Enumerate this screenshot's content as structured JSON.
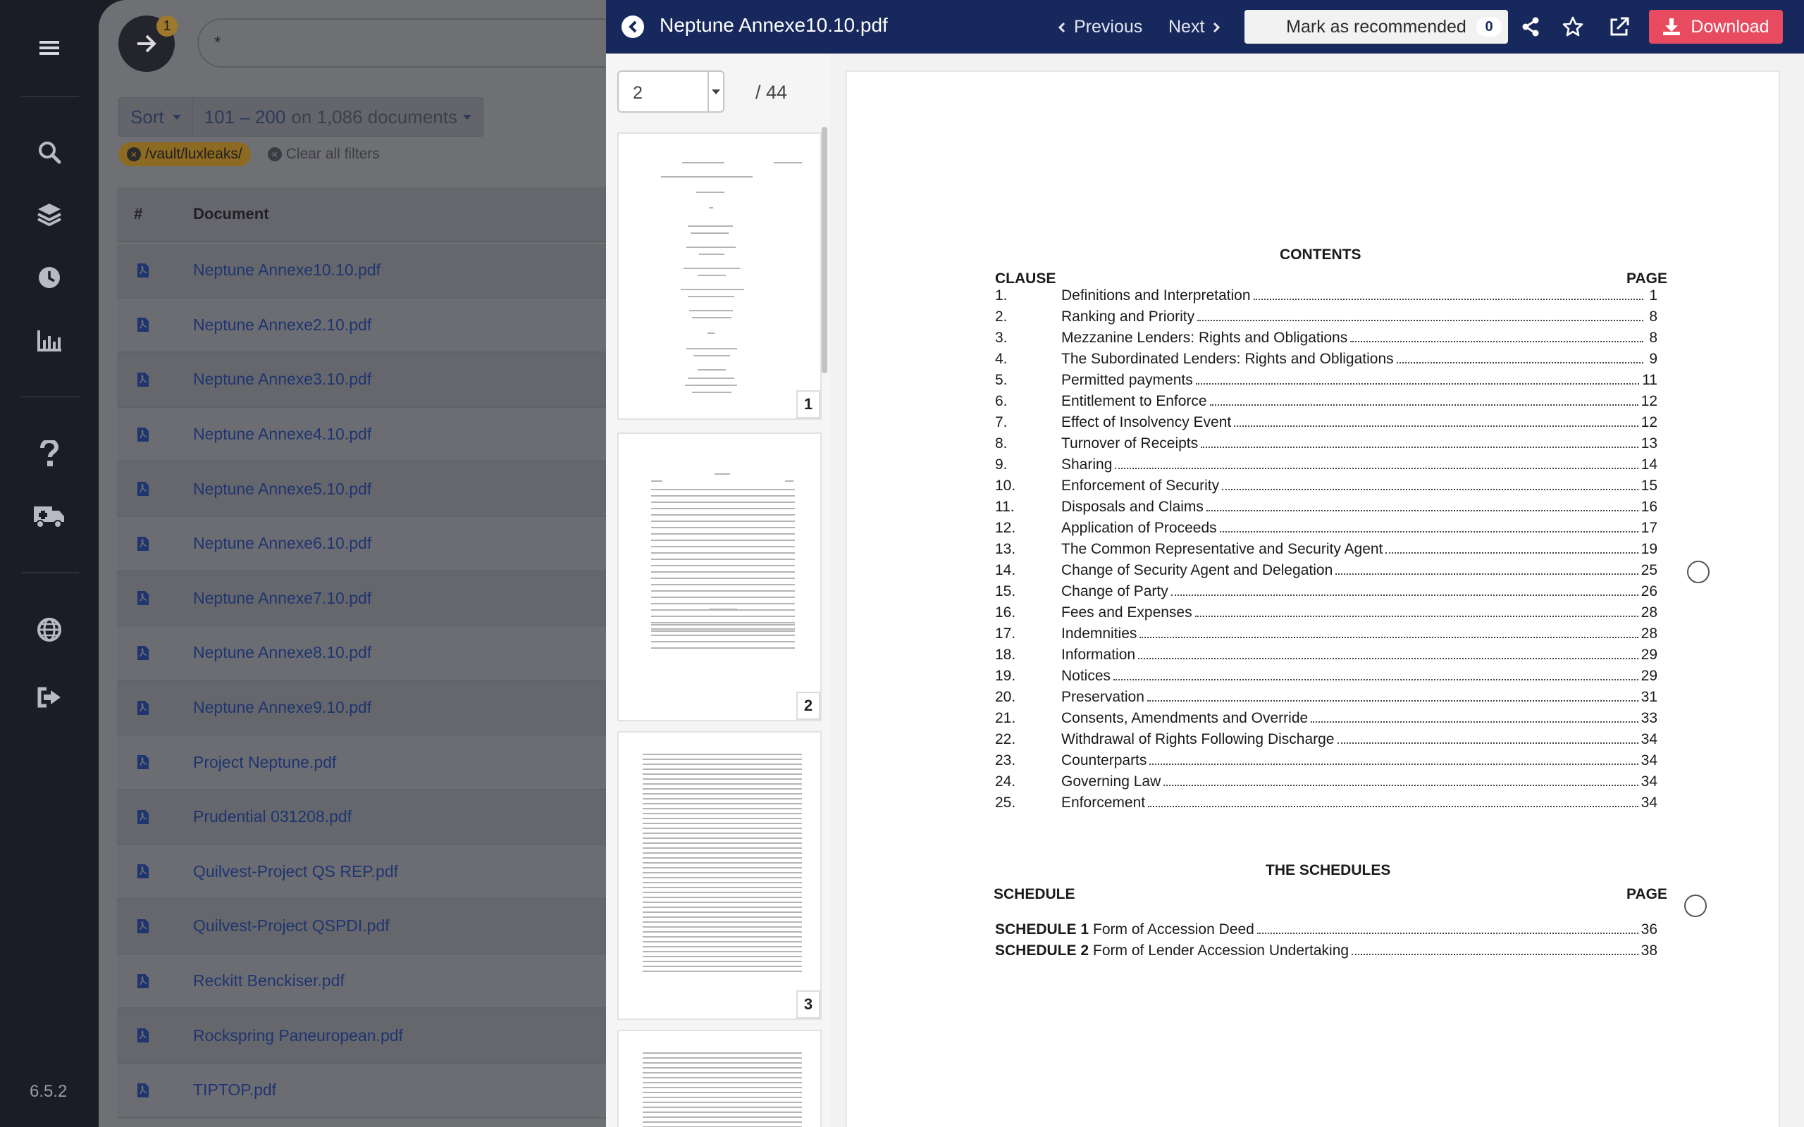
{
  "app": {
    "version": "6.5.2",
    "sidebar_icons": [
      "menu-icon",
      "search-icon",
      "layers-icon",
      "history-icon",
      "chart-icon",
      "help-icon",
      "truck-icon",
      "globe-icon",
      "logout-icon"
    ]
  },
  "search": {
    "go_badge": "1",
    "query": "*",
    "sort_label": "Sort",
    "range": "101 – 200",
    "range_suffix": "on 1,086 documents",
    "path_filter": "/vault/luxleaks/",
    "clear_filters": "Clear all filters",
    "col_num": "#",
    "col_document": "Document",
    "documents": [
      "Neptune Annexe10.10.pdf",
      "Neptune Annexe2.10.pdf",
      "Neptune Annexe3.10.pdf",
      "Neptune Annexe4.10.pdf",
      "Neptune Annexe5.10.pdf",
      "Neptune Annexe6.10.pdf",
      "Neptune Annexe7.10.pdf",
      "Neptune Annexe8.10.pdf",
      "Neptune Annexe9.10.pdf",
      "Project Neptune.pdf",
      "Prudential 031208.pdf",
      "Quilvest-Project QS REP.pdf",
      "Quilvest-Project QSPDI.pdf",
      "Reckitt Benckiser.pdf",
      "Rockspring Paneuropean.pdf",
      "TIPTOP.pdf"
    ]
  },
  "viewer": {
    "title": "Neptune Annexe10.10.pdf",
    "previous": "Previous",
    "next": "Next",
    "recommend": "Mark as recommended",
    "recommend_count": "0",
    "download": "Download",
    "accent": "#e84a5f",
    "header_bg": "#17295c",
    "current_page": "2",
    "total_pages": "/ 44",
    "thumb_pages": [
      "1",
      "2",
      "3"
    ]
  },
  "document": {
    "contents_title": "CONTENTS",
    "clause_label": "CLAUSE",
    "page_label": "PAGE",
    "toc": [
      {
        "num": "1.",
        "title": "Definitions and Interpretation",
        "page": "1"
      },
      {
        "num": "2.",
        "title": "Ranking and Priority",
        "page": "8"
      },
      {
        "num": "3.",
        "title": "Mezzanine Lenders: Rights and Obligations",
        "page": "8"
      },
      {
        "num": "4.",
        "title": "The Subordinated Lenders: Rights and Obligations",
        "page": "9"
      },
      {
        "num": "5.",
        "title": "Permitted payments",
        "page": "11"
      },
      {
        "num": "6.",
        "title": "Entitlement to Enforce",
        "page": "12"
      },
      {
        "num": "7.",
        "title": "Effect of Insolvency Event",
        "page": "12"
      },
      {
        "num": "8.",
        "title": "Turnover of Receipts",
        "page": "13"
      },
      {
        "num": "9.",
        "title": "Sharing",
        "page": "14"
      },
      {
        "num": "10.",
        "title": "Enforcement of Security",
        "page": "15"
      },
      {
        "num": "11.",
        "title": "Disposals and Claims",
        "page": "16"
      },
      {
        "num": "12.",
        "title": "Application of Proceeds",
        "page": "17"
      },
      {
        "num": "13.",
        "title": "The Common Representative and Security Agent",
        "page": "19"
      },
      {
        "num": "14.",
        "title": "Change of Security Agent and Delegation",
        "page": "25"
      },
      {
        "num": "15.",
        "title": "Change of Party",
        "page": "26"
      },
      {
        "num": "16.",
        "title": "Fees and Expenses",
        "page": "28"
      },
      {
        "num": "17.",
        "title": "Indemnities",
        "page": "28"
      },
      {
        "num": "18.",
        "title": "Information",
        "page": "29"
      },
      {
        "num": "19.",
        "title": "Notices",
        "page": "29"
      },
      {
        "num": "20.",
        "title": "Preservation",
        "page": "31"
      },
      {
        "num": "21.",
        "title": "Consents, Amendments and Override",
        "page": "33"
      },
      {
        "num": "22.",
        "title": "Withdrawal of Rights Following Discharge",
        "page": "34"
      },
      {
        "num": "23.",
        "title": "Counterparts",
        "page": "34"
      },
      {
        "num": "24.",
        "title": "Governing Law",
        "page": "34"
      },
      {
        "num": "25.",
        "title": "Enforcement",
        "page": "34"
      }
    ],
    "schedules_title": "THE SCHEDULES",
    "schedule_label": "SCHEDULE",
    "schedule_page_label": "PAGE",
    "schedules": [
      {
        "label": "SCHEDULE 1",
        "title": "Form of Accession Deed",
        "page": "36"
      },
      {
        "label": "SCHEDULE 2",
        "title": "Form of Lender Accession Undertaking",
        "page": "38"
      }
    ]
  }
}
